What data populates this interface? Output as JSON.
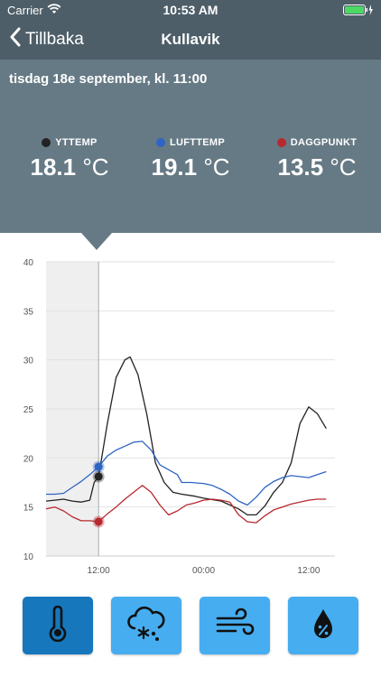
{
  "status_bar": {
    "carrier": "Carrier",
    "time": "10:53 AM"
  },
  "nav": {
    "back_label": "Tillbaka",
    "title": "Kullavik"
  },
  "header": {
    "datetime": "tisdag 18e september, kl. 11:00",
    "readings": [
      {
        "label": "YTTEMP",
        "value": "18.1",
        "unit": "°C",
        "color": "#222222"
      },
      {
        "label": "LUFTTEMP",
        "value": "19.1",
        "unit": "°C",
        "color": "#2f64c4"
      },
      {
        "label": "DAGGPUNKT",
        "value": "13.5",
        "unit": "°C",
        "color": "#b8282e"
      }
    ]
  },
  "chart_data": {
    "type": "line",
    "ylim": [
      10,
      40
    ],
    "yticks": [
      "10",
      "15",
      "20",
      "25",
      "30",
      "35",
      "40"
    ],
    "xticks": [
      {
        "label": "12:00",
        "x": 1
      },
      {
        "label": "00:00",
        "x": 13
      },
      {
        "label": "12:00",
        "x": 25
      }
    ],
    "xlim": [
      -5,
      28
    ],
    "highlight_range": [
      -5,
      1
    ],
    "current_x": 1,
    "grid": true,
    "series": [
      {
        "name": "YTTEMP",
        "color": "#222222",
        "marker": 18.1,
        "points": [
          [
            -5,
            15.6
          ],
          [
            -4,
            15.7
          ],
          [
            -3,
            15.8
          ],
          [
            -2,
            15.6
          ],
          [
            -1,
            15.5
          ],
          [
            0,
            15.7
          ],
          [
            0.5,
            17.5
          ],
          [
            1,
            18.1
          ],
          [
            2,
            23.5
          ],
          [
            3,
            28.2
          ],
          [
            4,
            30.0
          ],
          [
            4.6,
            30.3
          ],
          [
            5.5,
            28.5
          ],
          [
            6.5,
            24.5
          ],
          [
            7.5,
            19.5
          ],
          [
            8.5,
            17.5
          ],
          [
            9.5,
            16.5
          ],
          [
            10.5,
            16.3
          ],
          [
            12,
            16.1
          ],
          [
            13,
            15.9
          ],
          [
            15,
            15.6
          ],
          [
            17,
            14.8
          ],
          [
            18,
            14.2
          ],
          [
            19,
            14.2
          ],
          [
            20,
            15.1
          ],
          [
            21,
            16.5
          ],
          [
            22,
            17.5
          ],
          [
            23,
            19.5
          ],
          [
            24,
            23.5
          ],
          [
            25,
            25.2
          ],
          [
            26,
            24.5
          ],
          [
            27,
            23.0
          ]
        ]
      },
      {
        "name": "LUFTTEMP",
        "color": "#2f64c4",
        "marker": 19.1,
        "points": [
          [
            -5,
            16.3
          ],
          [
            -4,
            16.3
          ],
          [
            -3,
            16.4
          ],
          [
            -2,
            17.0
          ],
          [
            -1,
            17.6
          ],
          [
            0,
            18.3
          ],
          [
            1,
            19.1
          ],
          [
            2,
            20.2
          ],
          [
            3,
            20.8
          ],
          [
            4,
            21.2
          ],
          [
            5,
            21.6
          ],
          [
            6,
            21.7
          ],
          [
            7,
            20.8
          ],
          [
            8,
            19.3
          ],
          [
            9,
            18.8
          ],
          [
            10,
            18.3
          ],
          [
            10.5,
            17.5
          ],
          [
            11.5,
            17.5
          ],
          [
            13,
            17.4
          ],
          [
            14,
            17.2
          ],
          [
            15,
            16.8
          ],
          [
            16,
            16.3
          ],
          [
            17,
            15.6
          ],
          [
            18,
            15.2
          ],
          [
            19,
            16.0
          ],
          [
            20,
            17.0
          ],
          [
            21,
            17.6
          ],
          [
            22,
            18.0
          ],
          [
            23,
            18.2
          ],
          [
            24,
            18.1
          ],
          [
            25,
            18.0
          ],
          [
            26,
            18.3
          ],
          [
            27,
            18.6
          ]
        ]
      },
      {
        "name": "DAGGPUNKT",
        "color": "#b8282e",
        "marker": 13.5,
        "points": [
          [
            -5,
            14.8
          ],
          [
            -4,
            15.0
          ],
          [
            -3,
            14.6
          ],
          [
            -2,
            14.0
          ],
          [
            -1,
            13.6
          ],
          [
            0,
            13.6
          ],
          [
            1,
            13.5
          ],
          [
            2,
            14.3
          ],
          [
            3,
            15.0
          ],
          [
            4,
            15.8
          ],
          [
            5,
            16.5
          ],
          [
            6,
            17.2
          ],
          [
            7,
            16.5
          ],
          [
            8,
            15.2
          ],
          [
            9,
            14.2
          ],
          [
            10,
            14.6
          ],
          [
            11,
            15.2
          ],
          [
            12,
            15.4
          ],
          [
            13,
            15.7
          ],
          [
            14,
            15.8
          ],
          [
            15,
            15.7
          ],
          [
            16,
            15.5
          ],
          [
            17,
            14.2
          ],
          [
            18,
            13.5
          ],
          [
            19,
            13.4
          ],
          [
            20,
            14.1
          ],
          [
            21,
            14.7
          ],
          [
            22,
            15.0
          ],
          [
            23,
            15.3
          ],
          [
            24,
            15.5
          ],
          [
            25,
            15.7
          ],
          [
            26,
            15.8
          ],
          [
            27,
            15.8
          ]
        ]
      }
    ]
  },
  "toolbar": {
    "buttons": [
      {
        "icon": "thermometer-icon",
        "active": true
      },
      {
        "icon": "snow-cloud-icon",
        "active": false
      },
      {
        "icon": "wind-icon",
        "active": false
      },
      {
        "icon": "humidity-drop-icon",
        "active": false
      }
    ]
  }
}
